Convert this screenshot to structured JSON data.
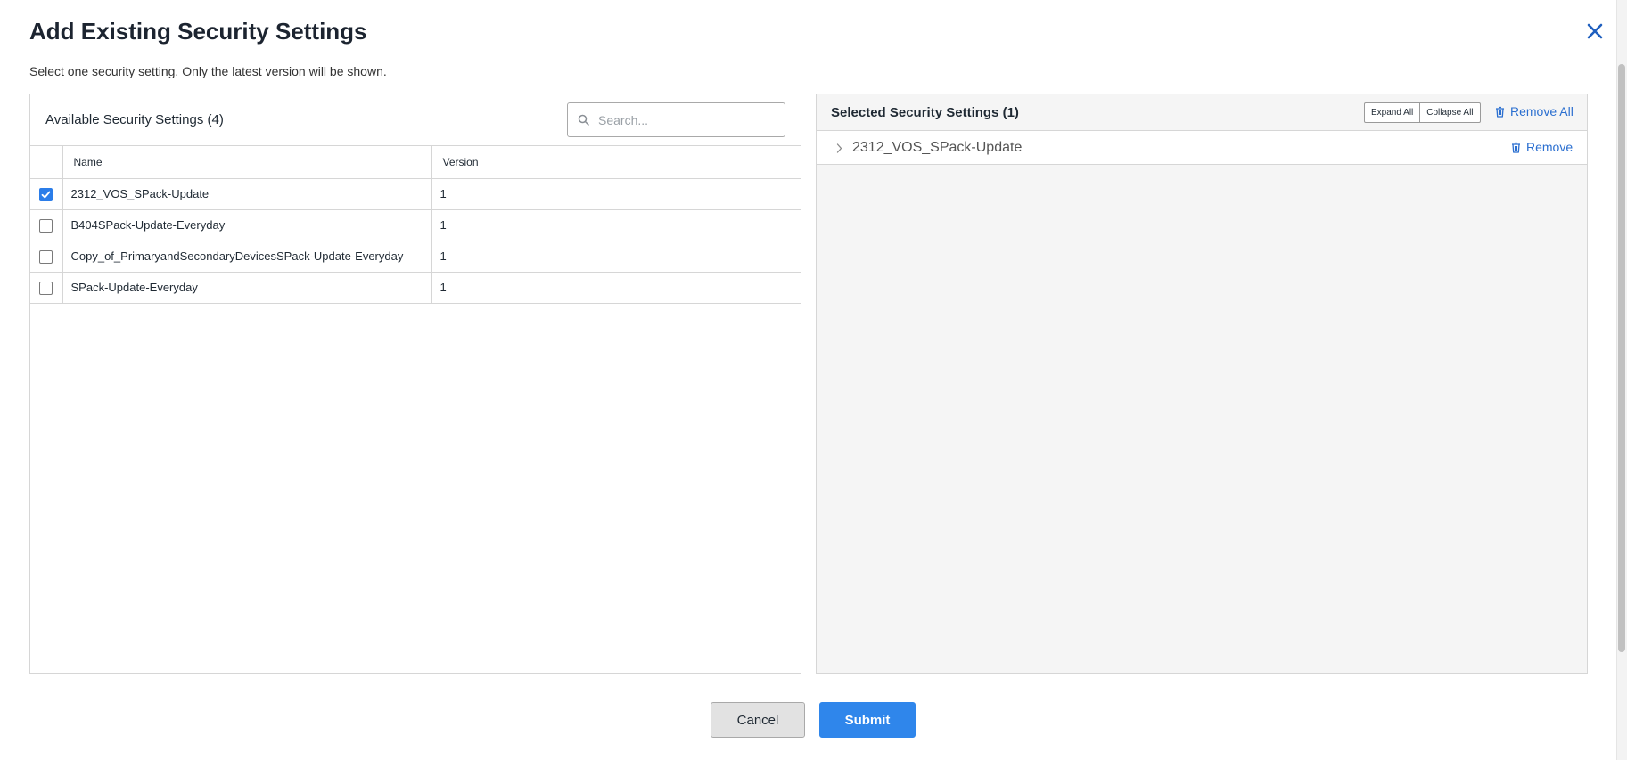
{
  "dialog": {
    "title": "Add Existing Security Settings",
    "subtitle": "Select one security setting. Only the latest version will be shown."
  },
  "available": {
    "title": "Available Security Settings (4)",
    "search_placeholder": "Search...",
    "columns": {
      "name": "Name",
      "version": "Version"
    },
    "rows": [
      {
        "name": "2312_VOS_SPack-Update",
        "version": "1",
        "checked": true
      },
      {
        "name": "B404SPack-Update-Everyday",
        "version": "1",
        "checked": false
      },
      {
        "name": "Copy_of_PrimaryandSecondaryDevicesSPack-Update-Everyday",
        "version": "1",
        "checked": false
      },
      {
        "name": "SPack-Update-Everyday",
        "version": "1",
        "checked": false
      }
    ]
  },
  "selected": {
    "title": "Selected Security Settings (1)",
    "expand_all": "Expand All",
    "collapse_all": "Collapse All",
    "remove_all": "Remove All",
    "items": [
      {
        "name": "2312_VOS_SPack-Update",
        "remove_label": "Remove"
      }
    ]
  },
  "footer": {
    "cancel": "Cancel",
    "submit": "Submit"
  },
  "colors": {
    "accent": "#2f86eb",
    "link": "#2b6fd0",
    "checkbox_checked": "#2b7de9"
  },
  "icons": {
    "close": "close-icon",
    "search": "search-icon",
    "trash": "trash-icon",
    "chevron": "chevron-right-icon",
    "check": "check-icon"
  }
}
